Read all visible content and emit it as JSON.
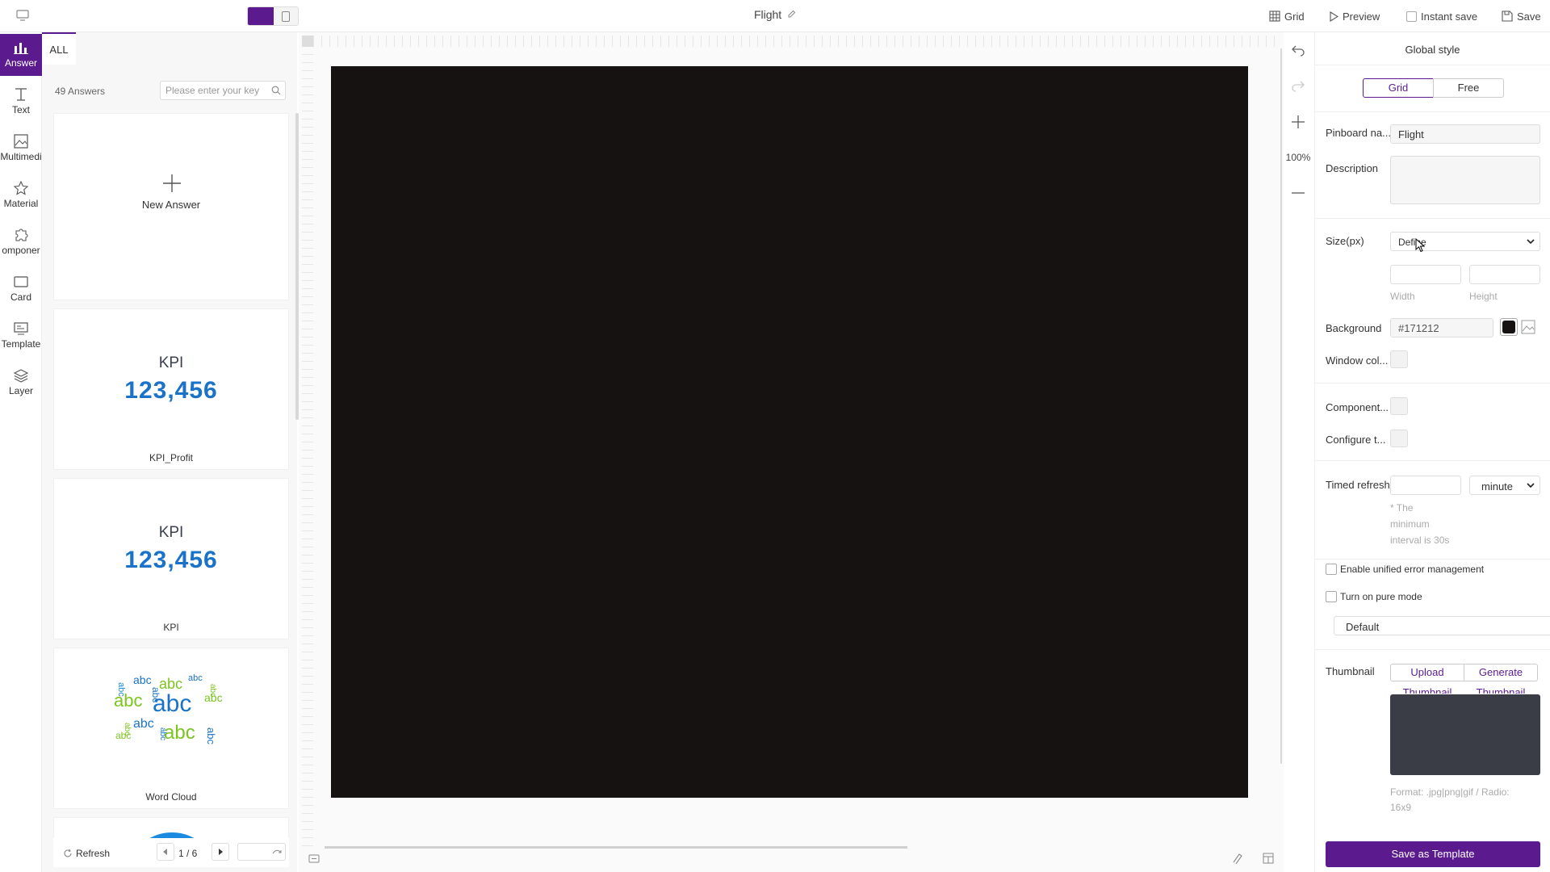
{
  "topbar": {
    "title": "Flight",
    "grid_label": "Grid",
    "preview_label": "Preview",
    "instant_save_label": "Instant save",
    "save_label": "Save"
  },
  "leftnav": {
    "items": [
      {
        "label": "Answer",
        "icon": "bar-chart-icon",
        "active": true
      },
      {
        "label": "Text",
        "icon": "text-icon"
      },
      {
        "label": "Multimedi",
        "icon": "image-icon"
      },
      {
        "label": "Material",
        "icon": "star-icon"
      },
      {
        "label": "omponer",
        "icon": "puzzle-icon"
      },
      {
        "label": "Card",
        "icon": "card-icon"
      },
      {
        "label": "Template",
        "icon": "template-icon"
      },
      {
        "label": "Layer",
        "icon": "layers-icon"
      }
    ]
  },
  "panel": {
    "tab_all": "ALL",
    "count": "49 Answers",
    "search_placeholder": "Please enter your key",
    "new_answer": "New Answer",
    "cards": [
      {
        "kpi_top": "KPI",
        "kpi_value": "123,456",
        "label": "KPI_Profit"
      },
      {
        "kpi_top": "KPI",
        "kpi_value": "123,456",
        "label": "KPI"
      }
    ],
    "wordcloud_label": "Word Cloud",
    "wordcloud_word": "abc",
    "refresh": "Refresh",
    "page": "1 / 6"
  },
  "canvas": {
    "zoom": "100%",
    "background_color": "#171212"
  },
  "right": {
    "title": "Global style",
    "mode_grid": "Grid",
    "mode_free": "Free",
    "pinboard_label": "Pinboard na...",
    "pinboard_value": "Flight",
    "description_label": "Description",
    "size_label": "Size(px)",
    "size_value": "Define",
    "width_label": "Width",
    "height_label": "Height",
    "background_label": "Background",
    "background_value": "#171212",
    "window_label": "Window col...",
    "component_label": "Component...",
    "configure_label": "Configure t...",
    "timed_refresh_label": "Timed refresh",
    "timed_unit": "minute",
    "min_hint_1": "* The",
    "min_hint_2": "minimum",
    "min_hint_3": "interval is 30s",
    "error_mgmt": "Enable unified error management",
    "pure_mode": "Turn on pure mode",
    "theme_value": "Default",
    "thumbnail_label": "Thumbnail",
    "upload_label": "Upload",
    "generate_label": "Generate",
    "thumb_sub_1": "Thumbnail",
    "thumb_sub_2": "Thumbnail",
    "format_hint_1": "Format: .jpg|png|gif / Radio:",
    "format_hint_2": "16x9",
    "save_template": "Save as Template"
  },
  "colors": {
    "accent": "#5b1b8f",
    "kpi_blue": "#1a73c9",
    "canvas_bg": "#171212"
  }
}
